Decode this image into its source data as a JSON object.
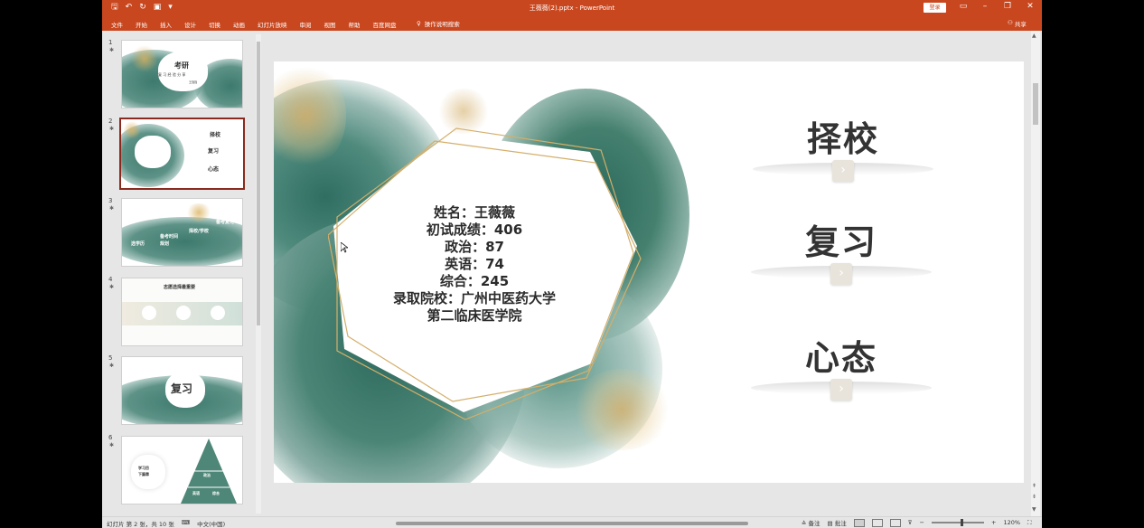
{
  "titlebar": {
    "title": "王薇薇(2).pptx  -  PowerPoint",
    "login": "登录",
    "icons": [
      "save-icon",
      "undo-icon",
      "redo-icon",
      "start-from-beginning-icon"
    ]
  },
  "ribbon": {
    "tabs": [
      "文件",
      "开始",
      "插入",
      "设计",
      "切换",
      "动画",
      "幻灯片放映",
      "审阅",
      "视图",
      "帮助",
      "百度网盘"
    ],
    "search_label": "操作说明搜索",
    "share_label": "共享"
  },
  "thumbnails": [
    {
      "num": "1",
      "title": "考研",
      "subtitle": "复 习 经 验 分 享",
      "author": "王薇薇"
    },
    {
      "num": "2",
      "items": [
        "择校",
        "复习",
        "心态"
      ]
    },
    {
      "num": "3",
      "labels": [
        "备考时间",
        "规划",
        "选学历",
        "择校/学校",
        "备考复习"
      ]
    },
    {
      "num": "4",
      "title": "志愿选择最重要"
    },
    {
      "num": "5",
      "title": "复习"
    },
    {
      "num": "6",
      "labels": [
        "学习目",
        "下篇章",
        "政治",
        "英语",
        "综合"
      ]
    }
  ],
  "slide": {
    "lines": [
      "姓名：王薇薇",
      "初试成绩：406",
      "政治：87",
      "英语：74",
      "综合：245",
      "录取院校：广州中医药大学",
      "第二临床医学院"
    ],
    "menu": [
      "择校",
      "复习",
      "心态"
    ],
    "arrow_glyph": "›"
  },
  "status": {
    "slide_count": "幻灯片 第 2 张，共 10 张",
    "language": "中文(中国)",
    "notes": "备注",
    "comments": "批注",
    "zoom": "120%",
    "zoom_minus": "−",
    "zoom_plus": "+"
  },
  "colors": {
    "accent": "#c8471f",
    "selected_thumb": "#8a2a1e",
    "ink_green": "#3d7a6d",
    "gold": "#d4af6a"
  }
}
